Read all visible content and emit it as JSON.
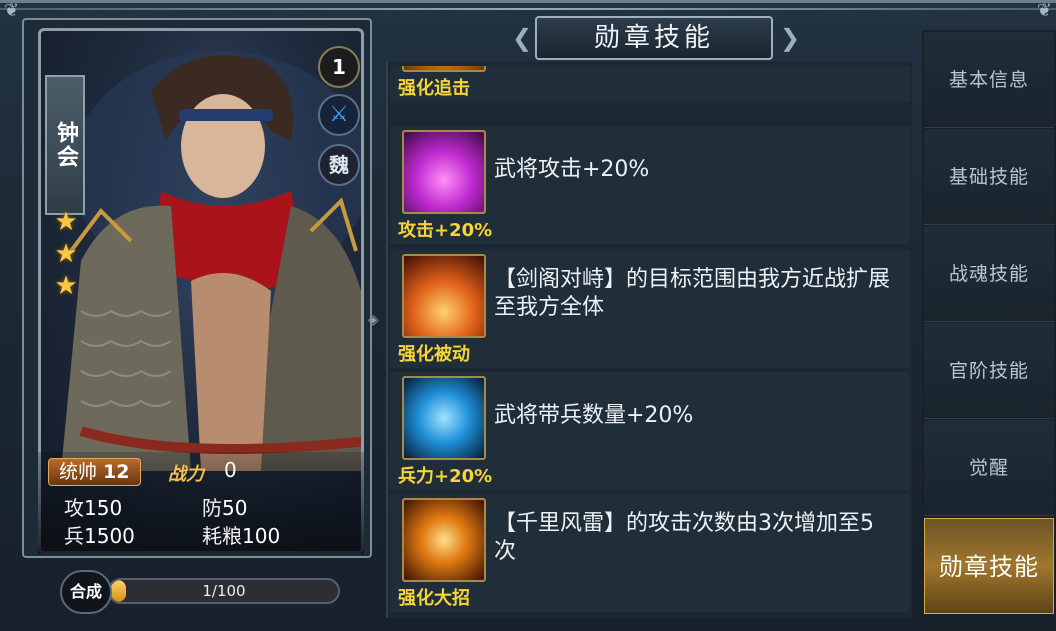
{
  "title": "勋章技能",
  "hero": {
    "name": "钟会",
    "stars": 3,
    "level": "1",
    "type_icon": "sword-icon",
    "faction": "魏",
    "command_label": "统帅",
    "command_value": "12",
    "power_label": "战力",
    "power_value": "0",
    "stats": [
      {
        "label": "攻",
        "value": "150"
      },
      {
        "label": "防",
        "value": "50"
      },
      {
        "label": "兵",
        "value": "1500"
      },
      {
        "label": "耗粮",
        "value": "100"
      }
    ]
  },
  "synth": {
    "button_label": "合成",
    "progress_text": "1/100",
    "progress_fraction": 0.01
  },
  "skills": [
    {
      "name": "强化追击",
      "desc": "",
      "icon": "chase-icon",
      "color": "#d07a14"
    },
    {
      "name": "攻击+20%",
      "desc": "武将攻击+20%",
      "icon": "attack-icon",
      "color": "#c02bd1"
    },
    {
      "name": "强化被动",
      "desc": "【剑阁对峙】的目标范围由我方近战扩展至我方全体",
      "icon": "passive-icon",
      "color": "#e0601a"
    },
    {
      "name": "兵力+20%",
      "desc": "武将带兵数量+20%",
      "icon": "troops-icon",
      "color": "#1f8fd8"
    },
    {
      "name": "强化大招",
      "desc": "【千里风雷】的攻击次数由3次增加至5次",
      "icon": "ultimate-icon",
      "color": "#e07a12"
    }
  ],
  "tabs": [
    {
      "label": "基本信息",
      "active": false
    },
    {
      "label": "基础技能",
      "active": false
    },
    {
      "label": "战魂技能",
      "active": false
    },
    {
      "label": "官阶技能",
      "active": false
    },
    {
      "label": "觉醒",
      "active": false
    },
    {
      "label": "勋章技能",
      "active": true
    }
  ],
  "colors": {
    "accent_gold": "#f6d53a",
    "active_tab": "#a0762c",
    "panel": "#1b2833"
  }
}
